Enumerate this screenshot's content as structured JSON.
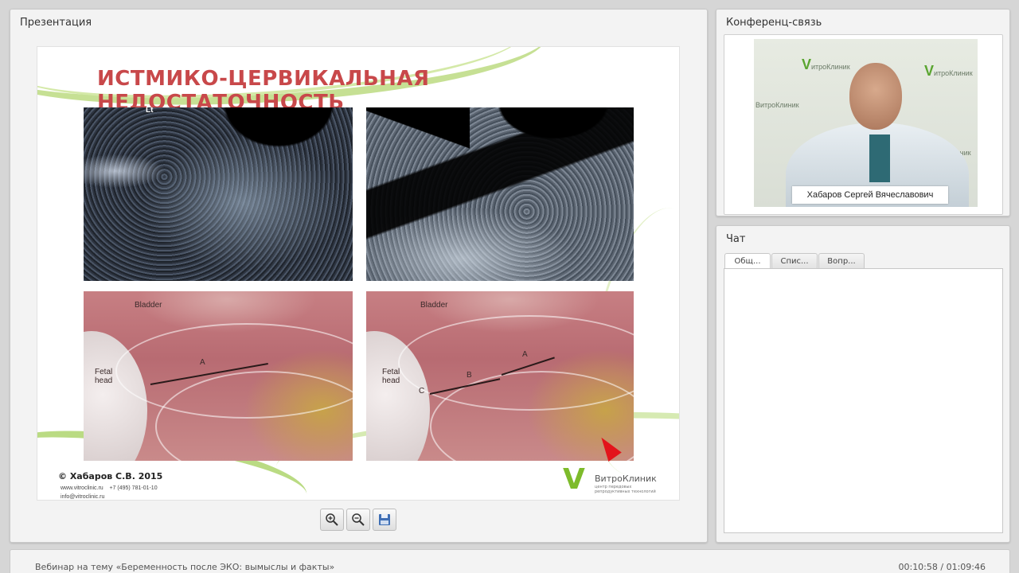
{
  "presentation": {
    "title": "Презентация",
    "slide": {
      "heading": "ИСТМИКО-ЦЕРВИКАЛЬНАЯ НЕДОСТАТОЧНОСТЬ",
      "images": {
        "us1_label": "Lt",
        "anat1": {
          "bladder": "Bladder",
          "fetal": "Fetal head",
          "a": "A"
        },
        "anat2": {
          "bladder": "Bladder",
          "fetal": "Fetal head",
          "a": "A",
          "b": "B",
          "c": "C"
        }
      },
      "copyright": "© Хабаров С.В. 2015",
      "contact_site": "www.vitroclinic.ru",
      "contact_phone": "+7 (495) 781-01-10",
      "contact_email": "info@vitroclinic.ru",
      "brand_name": "ВитроКлиник",
      "brand_sub": "центр передовых репродуктивных технологий"
    },
    "toolbar": {
      "zoom_in_icon": "zoom-in-icon",
      "zoom_out_icon": "zoom-out-icon",
      "save_icon": "save-icon"
    }
  },
  "conference": {
    "title": "Конференц-связь",
    "speaker_name": "Хабаров Сергей Вячеславович",
    "logo_text": "ВитроКлиник"
  },
  "chat": {
    "title": "Чат",
    "tabs": [
      "Общ...",
      "Спис...",
      "Вопр..."
    ]
  },
  "footer": {
    "webinar_title": "Вебинар на тему «Беременность после ЭКО: вымыслы и факты»",
    "time": "00:10:58 / 01:09:46"
  },
  "colors": {
    "accent_green": "#7dbb2b",
    "title_red": "#c8484a",
    "cursor_red": "#e3141b"
  }
}
